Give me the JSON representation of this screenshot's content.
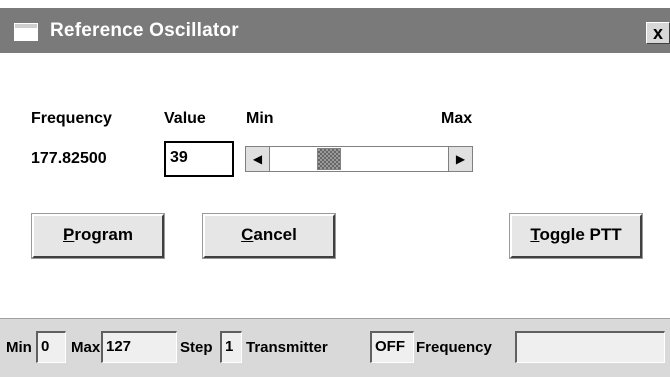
{
  "window": {
    "title": "Reference Oscillator",
    "close_label": "x"
  },
  "fields": {
    "frequency_label": "Frequency",
    "frequency_value": "177.82500",
    "value_label": "Value",
    "value_input": "39",
    "min_label": "Min",
    "max_label": "Max"
  },
  "slider": {
    "min": 0,
    "max": 127,
    "value": 39,
    "left_arrow": "◀",
    "right_arrow": "▶"
  },
  "buttons": {
    "program": {
      "mnemonic": "P",
      "rest": "rogram"
    },
    "cancel": {
      "mnemonic": "C",
      "rest": "ancel"
    },
    "toggle_ptt": {
      "mnemonic": "T",
      "rest": "oggle PTT"
    }
  },
  "status": {
    "min_label": "Min",
    "min_value": "0",
    "max_label": "Max",
    "max_value": "127",
    "step_label": "Step",
    "step_value": "1",
    "transmitter_label": "Transmitter",
    "transmitter_value": "OFF",
    "frequency_label": "Frequency",
    "frequency_value": ""
  },
  "colors": {
    "titlebar": "#7a7a7a",
    "statusbar": "#d9d9d9",
    "button": "#e6e6e6"
  }
}
